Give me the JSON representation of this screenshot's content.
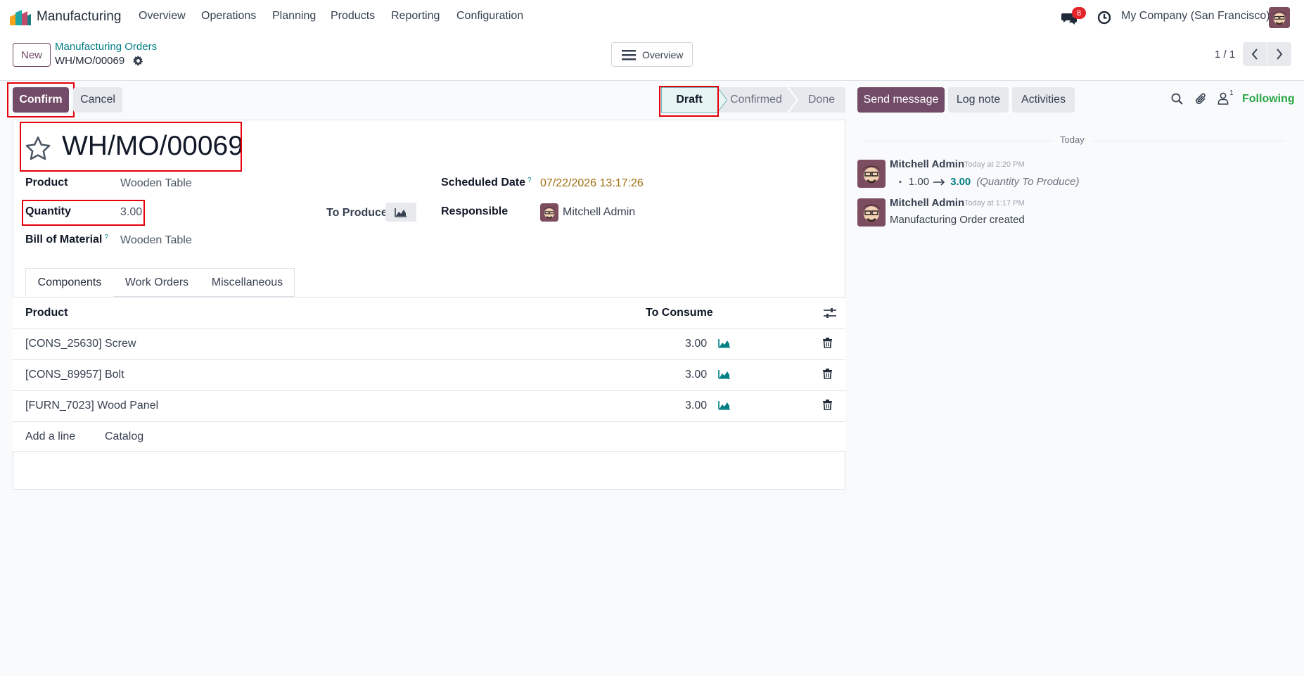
{
  "navbar": {
    "app_name": "Manufacturing",
    "menu": [
      "Overview",
      "Operations",
      "Planning",
      "Products",
      "Reporting",
      "Configuration"
    ],
    "messages_badge": "8",
    "company": "My Company (San Francisco)"
  },
  "control_panel": {
    "new_label": "New",
    "breadcrumb_parent": "Manufacturing Orders",
    "breadcrumb_current": "WH/MO/00069",
    "overview_label": "Overview",
    "pager": "1 / 1"
  },
  "statusbar": {
    "confirm_label": "Confirm",
    "cancel_label": "Cancel",
    "stages": [
      "Draft",
      "Confirmed",
      "Done"
    ],
    "active_stage": "Draft"
  },
  "form": {
    "title": "WH/MO/00069",
    "product_label": "Product",
    "product_value": "Wooden Table",
    "quantity_label": "Quantity",
    "quantity_value": "3.00",
    "to_produce_label": "To Produce",
    "bom_label": "Bill of Material",
    "bom_help": "?",
    "bom_value": "Wooden Table",
    "scheduled_label": "Scheduled Date",
    "scheduled_help": "?",
    "scheduled_value": "07/22/2026 13:17:26",
    "responsible_label": "Responsible",
    "responsible_value": "Mitchell Admin"
  },
  "tabs": [
    "Components",
    "Work Orders",
    "Miscellaneous"
  ],
  "components": {
    "col_product": "Product",
    "col_to_consume": "To Consume",
    "rows": [
      {
        "product": "[CONS_25630] Screw",
        "qty": "3.00"
      },
      {
        "product": "[CONS_89957] Bolt",
        "qty": "3.00"
      },
      {
        "product": "[FURN_7023] Wood Panel",
        "qty": "3.00"
      }
    ],
    "add_line": "Add a line",
    "catalog": "Catalog"
  },
  "chatter": {
    "send_message": "Send message",
    "log_note": "Log note",
    "activities": "Activities",
    "followers_count": "1",
    "following": "Following",
    "date_separator": "Today",
    "messages": [
      {
        "author": "Mitchell Admin",
        "time": "Today at 2:20 PM",
        "old_value": "1.00",
        "new_value": "3.00",
        "field": "(Quantity To Produce)"
      },
      {
        "author": "Mitchell Admin",
        "time": "Today at 1:17 PM",
        "body": "Manufacturing Order created"
      }
    ]
  },
  "colors": {
    "brand": "#714B67",
    "link": "#017e84",
    "warning_date": "#a06f0e",
    "highlight": "#e3000b"
  }
}
